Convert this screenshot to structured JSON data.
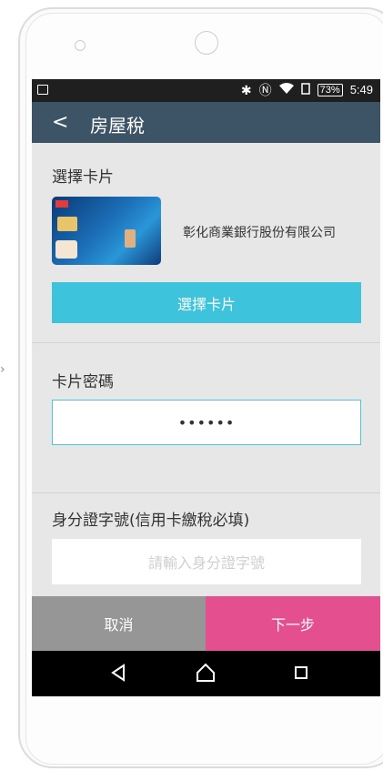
{
  "statusbar": {
    "battery": "73%",
    "time": "5:49"
  },
  "appbar": {
    "back_glyph": "<",
    "title": "房屋稅"
  },
  "card_section": {
    "label": "選擇卡片",
    "bank_name": "彰化商業銀行股份有限公司",
    "select_button": "選擇卡片"
  },
  "password_section": {
    "label": "卡片密碼",
    "value": "••••••"
  },
  "id_section": {
    "label": "身分證字號(信用卡繳稅必填)",
    "placeholder": "請輸入身分證字號"
  },
  "actions": {
    "cancel": "取消",
    "next": "下一步"
  },
  "colors": {
    "appbar": "#3d5366",
    "select_button": "#3dc3dc",
    "next_button": "#e4508f",
    "cancel_button": "#979697"
  }
}
